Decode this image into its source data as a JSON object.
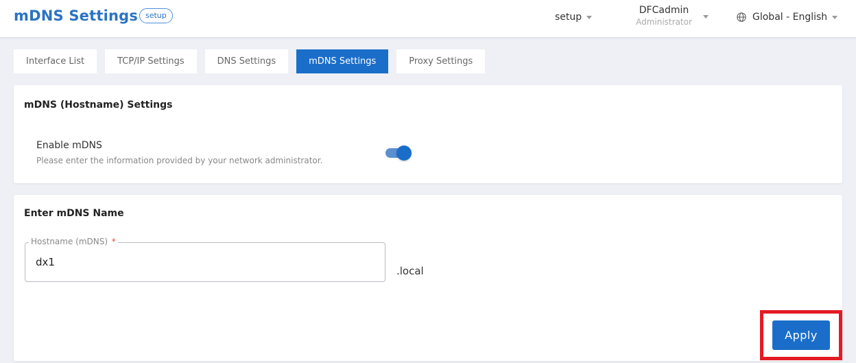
{
  "header": {
    "title": "mDNS Settings",
    "mode_badge": "setup",
    "mode_menu": "setup",
    "user_name": "DFCadmin",
    "user_role": "Administrator",
    "language": "Global - English",
    "language_icon": "globe-icon"
  },
  "tabs": [
    {
      "label": "Interface List",
      "active": false
    },
    {
      "label": "TCP/IP Settings",
      "active": false
    },
    {
      "label": "DNS Settings",
      "active": false
    },
    {
      "label": "mDNS Settings",
      "active": true
    },
    {
      "label": "Proxy Settings",
      "active": false
    }
  ],
  "hostname_section": {
    "title": "mDNS (Hostname) Settings",
    "enable_label": "Enable mDNS",
    "enable_help": "Please enter the information provided by your network administrator.",
    "enabled": true
  },
  "name_section": {
    "title": "Enter mDNS Name",
    "field_label": "Hostname (mDNS)",
    "required_mark": "*",
    "value": "dx1",
    "suffix": ".local"
  },
  "actions": {
    "apply_label": "Apply"
  },
  "colors": {
    "accent": "#1a6ec9",
    "highlight": "#e31b23"
  }
}
